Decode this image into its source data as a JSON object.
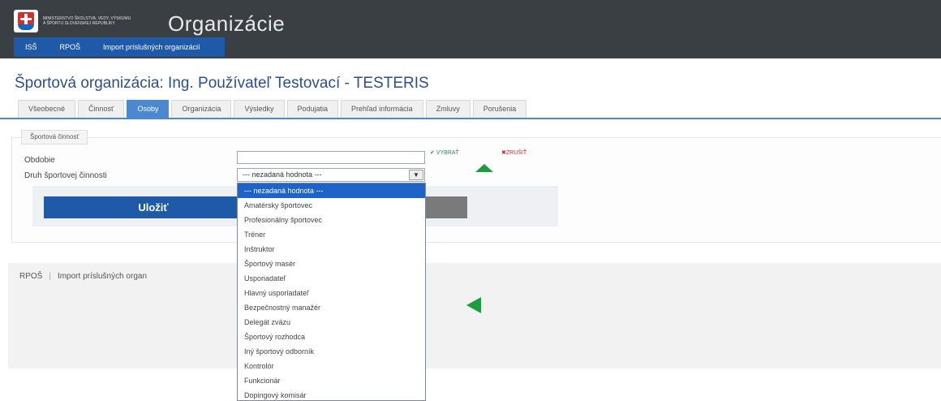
{
  "header": {
    "ministry_text": "MINISTERSTVO ŠKOLSTVA, VEDY, VÝSKUMU A ŠPORTU SLOVENSKEJ REPUBLIKY",
    "app_title": "Organizácie",
    "nav": [
      {
        "label": "ISŠ"
      },
      {
        "label": "RPOŠ"
      },
      {
        "label": "Import príslušných organizácií"
      }
    ]
  },
  "page": {
    "title": "Športová organizácia: Ing. Používateľ Testovací - TESTERIS"
  },
  "tabs": [
    {
      "label": "Všeobecné"
    },
    {
      "label": "Činnosť"
    },
    {
      "label": "Osoby"
    },
    {
      "label": "Organizácia"
    },
    {
      "label": "Výsledky"
    },
    {
      "label": "Podujatia"
    },
    {
      "label": "Prehľad informácia"
    },
    {
      "label": "Zmluvy"
    },
    {
      "label": "Porušenia"
    }
  ],
  "form": {
    "legend": "Športová činnosť",
    "obdobie_label": "Obdobie",
    "obdobie_value": "",
    "vybrat_label": "VYBRAŤ",
    "zrusit_label": "ZRUŠIŤ",
    "druh_label": "Druh športovej činnosti",
    "druh_selected": "--- nezadaná hodnota ---",
    "save_label": "Uložiť"
  },
  "dropdown": {
    "options": [
      "--- nezadaná hodnota ---",
      "Amatérsky športovec",
      "Profesionálny športovec",
      "Tréner",
      "Inštruktor",
      "Športový masér",
      "Usporiadateľ",
      "Hlavný usporiadateľ",
      "Bezpečnostný manažér",
      "Delegát zväzu",
      "Športový rozhodca",
      "Iný športový odborník",
      "Kontrolór",
      "Funkcionár",
      "Dopingový komisár"
    ],
    "selected_index": 0
  },
  "footer": {
    "links": [
      {
        "label": "RPOŠ"
      },
      {
        "label": "Import príslušných organ"
      }
    ]
  },
  "colors": {
    "header_bg": "#3a3f44",
    "brand_blue": "#1e5aa8",
    "active_tab": "#4a88cf",
    "annotation_green": "#1f9a3f",
    "title_blue": "#2d4f8a"
  }
}
